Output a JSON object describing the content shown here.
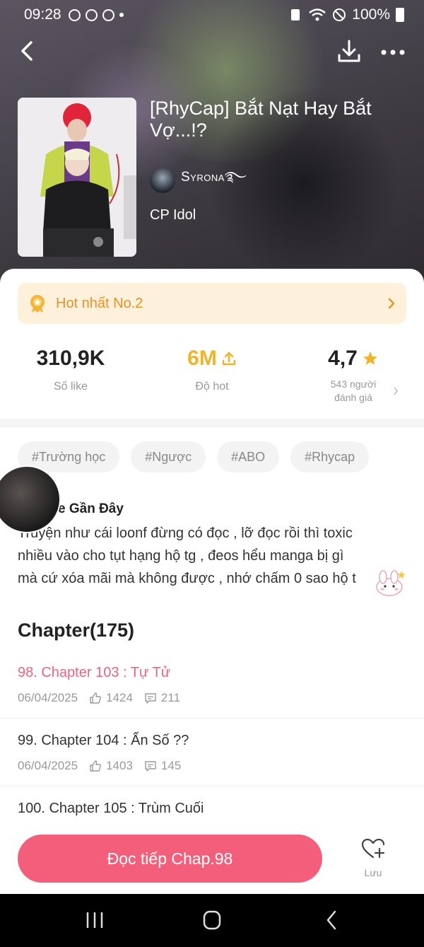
{
  "status_bar": {
    "time": "09:28",
    "battery": "100%"
  },
  "header": {
    "title": "[RhyCap] Bắt Nạt Hay Bắt Vợ...!?",
    "author": "Syrona࿐",
    "genre": "CP Idol"
  },
  "hot": {
    "label": "Hot nhất No.2"
  },
  "stats": {
    "likes": {
      "value": "310,9K",
      "label": "Số like"
    },
    "hot": {
      "value": "6M",
      "label": "Độ hot"
    },
    "rating": {
      "value": "4,7",
      "label_line1": "543 người",
      "label_line2": "đánh giá"
    }
  },
  "tags": [
    "#Trường học",
    "#Ngược",
    "#ABO",
    "#Rhycap"
  ],
  "review": {
    "heading": "e Gần Đây",
    "body": "Truyện như cái loonf đừng có đọc , lỡ đọc rồi thì toxic\nnhiều vào cho tụt hạng hộ tg , đeos hểu manga bị gì\nmà cứ xóa mãi mà không được , nhớ chấm 0 sao hộ t"
  },
  "chapters_header": "Chapter(175)",
  "chapters": [
    {
      "name": "98. Chapter 103 : Tự Tử",
      "date": "06/04/2025",
      "likes": "1424",
      "comments": "211"
    },
    {
      "name": "99. Chapter 104 : Ẩn Số ??",
      "date": "06/04/2025",
      "likes": "1403",
      "comments": "145"
    },
    {
      "name": "100. Chapter 105 : Trùm Cuối",
      "date": "",
      "likes": "",
      "comments": ""
    }
  ],
  "actions": {
    "read_continue": "Đọc tiếp Chap.98",
    "save": "Lưu"
  },
  "colors": {
    "accent": "#f35f7b",
    "hot": "#e8912a",
    "gold": "#f0b429"
  }
}
